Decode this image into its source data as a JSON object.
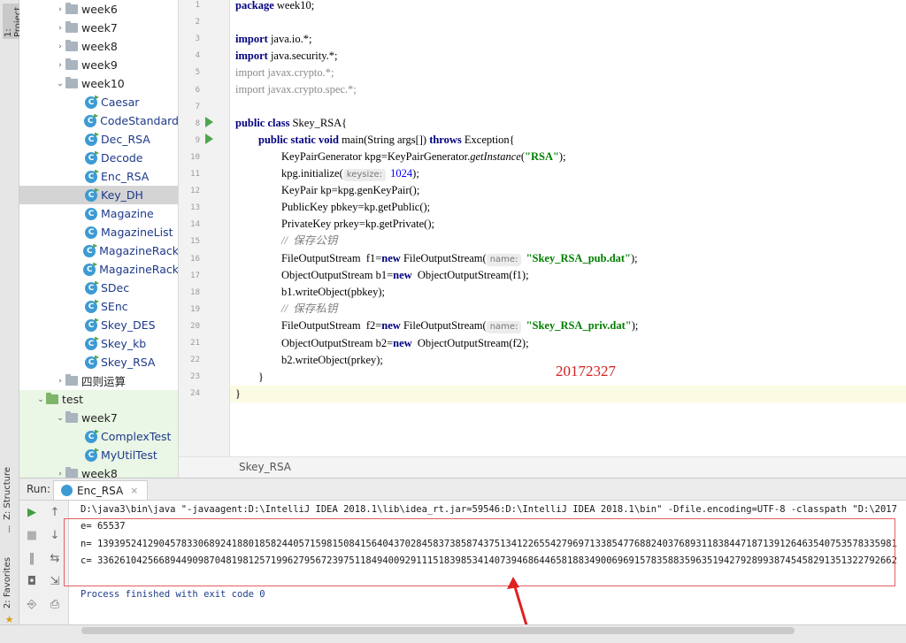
{
  "sidebar": {
    "project_tab": "1: Project",
    "structure_tab": "Z: Structure",
    "favorites_tab": "2: Favorites"
  },
  "tree": {
    "items": [
      {
        "label": "week6",
        "kind": "folder",
        "arrow": "›"
      },
      {
        "label": "week7",
        "kind": "folder",
        "arrow": "›"
      },
      {
        "label": "week8",
        "kind": "folder",
        "arrow": "›"
      },
      {
        "label": "week9",
        "kind": "folder",
        "arrow": "›"
      },
      {
        "label": "week10",
        "kind": "folder",
        "arrow": "⌄"
      },
      {
        "label": "Caesar",
        "kind": "class-run"
      },
      {
        "label": "CodeStandard",
        "kind": "class-run"
      },
      {
        "label": "Dec_RSA",
        "kind": "class-run"
      },
      {
        "label": "Decode",
        "kind": "class-run"
      },
      {
        "label": "Enc_RSA",
        "kind": "class-run"
      },
      {
        "label": "Key_DH",
        "kind": "class-run",
        "selected": true
      },
      {
        "label": "Magazine",
        "kind": "class"
      },
      {
        "label": "MagazineList",
        "kind": "class"
      },
      {
        "label": "MagazineRack",
        "kind": "class-run"
      },
      {
        "label": "MagazineRack",
        "kind": "class-run"
      },
      {
        "label": "SDec",
        "kind": "class-run"
      },
      {
        "label": "SEnc",
        "kind": "class-run"
      },
      {
        "label": "Skey_DES",
        "kind": "class-run"
      },
      {
        "label": "Skey_kb",
        "kind": "class-run"
      },
      {
        "label": "Skey_RSA",
        "kind": "class-run"
      },
      {
        "label": "四则运算",
        "kind": "folder",
        "arrow": "›"
      },
      {
        "label": "test",
        "kind": "folder-green",
        "arrow": "⌄"
      },
      {
        "label": "week7",
        "kind": "folder",
        "arrow": "⌄",
        "test": true
      },
      {
        "label": "ComplexTest",
        "kind": "class-run",
        "test": true
      },
      {
        "label": "MyUtilTest",
        "kind": "class-run",
        "test": true
      },
      {
        "label": "week8",
        "kind": "folder",
        "arrow": "›",
        "test": true
      }
    ]
  },
  "editor": {
    "line_numbers": [
      "1",
      "2",
      "3",
      "4",
      "5",
      "6",
      "7",
      "8",
      "9",
      "10",
      "11",
      "12",
      "13",
      "14",
      "15",
      "16",
      "17",
      "18",
      "19",
      "20",
      "21",
      "22",
      "23",
      "24"
    ],
    "code": {
      "l1_kw": "package",
      "l1_rest": " week10;",
      "l3_kw": "import",
      "l3_rest": " java.io.*;",
      "l4_kw": "import",
      "l4_rest": " java.security.*;",
      "l5": "import javax.crypto.*;",
      "l6": "import javax.crypto.spec.*;",
      "l8_kw": "public class",
      "l8_rest": " Skey_RSA{",
      "l9_kw1": "public static void",
      "l9_mid": " main(String args[]) ",
      "l9_kw2": "throws",
      "l9_rest": " Exception{",
      "l10_a": "KeyPairGenerator kpg=KeyPairGenerator.",
      "l10_it": "getInstance",
      "l10_b": "(",
      "l10_str": "\"RSA\"",
      "l10_c": ");",
      "l11_a": "kpg.initialize(",
      "l11_hint": "keysize:",
      "l11_num": " 1024",
      "l11_c": ");",
      "l12": "KeyPair kp=kpg.genKeyPair();",
      "l13": "PublicKey pbkey=kp.getPublic();",
      "l14": "PrivateKey prkey=kp.getPrivate();",
      "l15": "//  保存公钥",
      "l16_a": "FileOutputStream  f1=",
      "l16_kw": "new",
      "l16_b": " FileOutputStream(",
      "l16_hint": "name:",
      "l16_str": " \"Skey_RSA_pub.dat\"",
      "l16_c": ");",
      "l17_a": "ObjectOutputStream b1=",
      "l17_kw": "new",
      "l17_b": "  ObjectOutputStream(f1);",
      "l18": "b1.writeObject(pbkey);",
      "l19": "//  保存私钥",
      "l20_a": "FileOutputStream  f2=",
      "l20_kw": "new",
      "l20_b": " FileOutputStream(",
      "l20_hint": "name:",
      "l20_str": " \"Skey_RSA_priv.dat\"",
      "l20_c": ");",
      "l21_a": "ObjectOutputStream b2=",
      "l21_kw": "new",
      "l21_b": "  ObjectOutputStream(f2);",
      "l22": "b2.writeObject(prkey);",
      "l23": "}",
      "l24": "}"
    },
    "watermark": "20172327",
    "breadcrumb": "Skey_RSA"
  },
  "run": {
    "title": "Run:",
    "tab_label": "Enc_RSA",
    "tab_close": "×",
    "console": [
      "D:\\java3\\bin\\java \"-javaagent:D:\\IntelliJ IDEA 2018.1\\lib\\idea_rt.jar=59546:D:\\IntelliJ IDEA 2018.1\\bin\" -Dfile.encoding=UTF-8 -classpath \"D:\\2017",
      "e= 65537",
      "n= 13939524129045783306892418801858244057159815084156404370284583738587437513412265542796971338547768824037689311838447187139126463540753578335981",
      "c= 33626104256689449098704819812571996279567239751184940092911151839853414073946864465818834900696915783588359635194279289938745458291351322792662",
      "",
      "Process finished with exit code 0"
    ]
  },
  "colors": {
    "keyword": "#000080",
    "string": "#008000",
    "watermark": "#d32020",
    "highlight_box": "#e06060"
  }
}
